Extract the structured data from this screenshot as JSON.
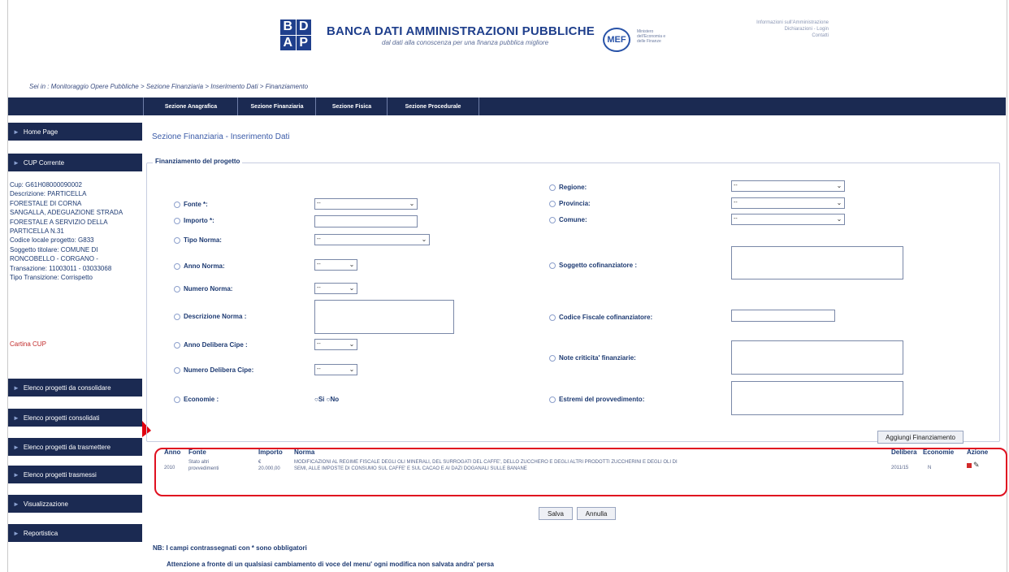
{
  "header": {
    "logo_letters": [
      "B",
      "D",
      "A",
      "P"
    ],
    "title": "BANCA DATI AMMINISTRAZIONI PUBBLICHE",
    "subtitle": "dal dati alla conoscenza per una finanza pubblica migliore",
    "mef_logo": "MEF",
    "mef_text": "Ministero dell'Economia e delle Finanze",
    "top_links": [
      "Informazioni sull'Amministrazione",
      "Dichiarazioni - Login",
      "Contatti"
    ]
  },
  "breadcrumb": "Sei in : Monitoraggio Opere Pubbliche > Sezione Finanziaria > Inserimento Dati > Finanziamento",
  "topnav": {
    "tabs": [
      "Sezione Anagrafica",
      "Sezione Finanziaria",
      "Sezione Fisica",
      "Sezione Procedurale"
    ]
  },
  "sidebar": {
    "home": "Home Page",
    "cup": "CUP Corrente",
    "cup_info": [
      "Cup: G61H08000090002",
      "Descrizione: PARTICELLA",
      "FORESTALE DI CORNA",
      "SANGALLA, ADEGUAZIONE STRADA",
      "FORESTALE A SERVIZIO DELLA",
      "PARTICELLA N.31",
      "Codice locale progetto: G833",
      "Soggetto titolare: COMUNE DI",
      "RONCOBELLO - CORGANO -",
      "Transazione: 11003011 - 03033068",
      "Tipo Transizione: Corrispetto"
    ],
    "cartina": "Cartina CUP",
    "menu": [
      "Elenco progetti da consolidare",
      "Elenco progetti consolidati",
      "Elenco progetti da trasmettere",
      "Elenco progetti trasmessi",
      "Visualizzazione",
      "Reportistica"
    ]
  },
  "main": {
    "section_title": "Sezione Finanziaria - Inserimento Dati",
    "legend": "Finanziamento del progetto",
    "left_fields": {
      "fonte": {
        "label": "Fonte *:",
        "value": "--"
      },
      "importo": {
        "label": "Importo *:",
        "value": ""
      },
      "tipo_norma": {
        "label": "Tipo Norma:",
        "value": "--"
      },
      "anno_norma": {
        "label": "Anno Norma:",
        "value": "--"
      },
      "numero_norma": {
        "label": "Numero Norma:",
        "value": "--"
      },
      "descrizione_norma": {
        "label": "Descrizione Norma :",
        "value": ""
      },
      "anno_delibera": {
        "label": "Anno Delibera Cipe :",
        "value": "--"
      },
      "numero_delibera": {
        "label": "Numero Delibera Cipe:",
        "value": "--"
      },
      "economie": {
        "label": "Economie :",
        "options": [
          "Si",
          "No"
        ]
      }
    },
    "right_fields": {
      "regione": {
        "label": "Regione:",
        "value": "--"
      },
      "provincia": {
        "label": "Provincia:",
        "value": "--"
      },
      "comune": {
        "label": "Comune:",
        "value": "--"
      },
      "soggetto": {
        "label": "Soggetto cofinanziatore :",
        "value": ""
      },
      "codice_fiscale": {
        "label": "Codice Fiscale cofinanziatore:",
        "value": ""
      },
      "note_criticita": {
        "label": "Note criticita' finanziarie:",
        "value": ""
      },
      "estremi": {
        "label": "Estremi del provvedimento:",
        "value": ""
      }
    },
    "add_button": "Aggiungi Finanziamento",
    "table": {
      "headers": [
        "Anno",
        "Fonte",
        "Importo",
        "Norma",
        "Delibera",
        "Economie",
        "Azione"
      ],
      "rows": [
        {
          "anno": "2010",
          "fonte": [
            "Stato altri",
            "provvedimenti"
          ],
          "importo": [
            "€",
            "20.000,00"
          ],
          "norma": [
            "MODIFICAZIONI AL REGIME FISCALE DEGLI OLI MINERALI, DEL SURROGATI DEL CAFFE', DELLO ZUCCHERO E DEGLI ALTRI PRODOTTI ZUCCHERINI E DEGLI OLI DI",
            "SEMI, ALLE IMPOSTE DI CONSUMO SUL CAFFE' E SUL CACAO E AI DAZI DOGANALI SULLE BANANE"
          ],
          "delibera": "2011/15",
          "economie": "N"
        }
      ]
    },
    "save_button": "Salva",
    "cancel_button": "Annulla",
    "nb": "NB: I campi contrassegnati con * sono obbligatori",
    "warning": "Attenzione a fronte di un qualsiasi cambiamento di voce del menu' ogni modifica non salvata andra' persa"
  },
  "colors": {
    "nav_bg": "#1b2a52",
    "accent": "#1f3f8c",
    "highlight": "#e01020"
  }
}
